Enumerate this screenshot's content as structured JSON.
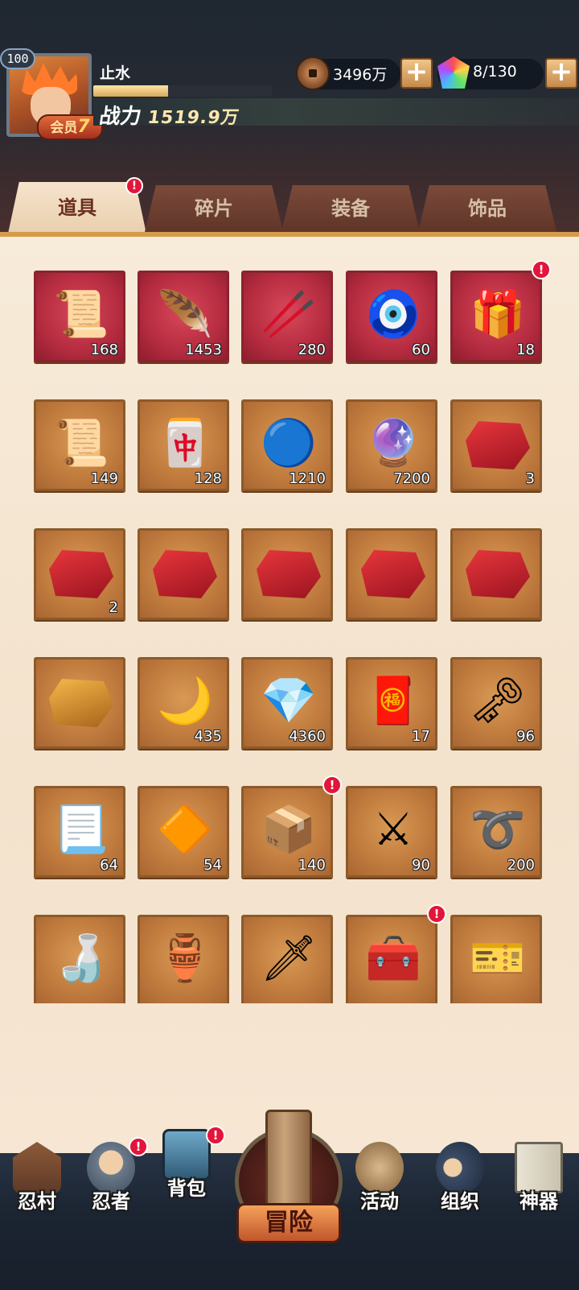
{
  "player": {
    "level": "100",
    "name": "止水",
    "vip_label": "会员",
    "vip_level": "7",
    "power_label": "战力",
    "power_value": "1519.9万",
    "exp_fraction": 0.42
  },
  "resources": {
    "coins": "3496万",
    "gems": "8/130",
    "plus_symbol": "+"
  },
  "tabs": [
    {
      "label": "道具",
      "active": true,
      "alert": "!"
    },
    {
      "label": "碎片",
      "active": false
    },
    {
      "label": "装备",
      "active": false
    },
    {
      "label": "饰品",
      "active": false
    }
  ],
  "items": [
    {
      "icon": "scroll-bundle-icon",
      "glyph": "📜",
      "count": "168",
      "rarity": "red"
    },
    {
      "icon": "red-feather-icon",
      "glyph": "🪶",
      "count": "1453",
      "rarity": "red"
    },
    {
      "icon": "wooden-stick-icon",
      "glyph": "🥢",
      "count": "280",
      "rarity": "red"
    },
    {
      "icon": "green-jade-pendant-icon",
      "glyph": "🧿",
      "count": "60",
      "rarity": "red"
    },
    {
      "icon": "gift-box-icon",
      "glyph": "🎁",
      "count": "18",
      "rarity": "red",
      "alert": "!"
    },
    {
      "icon": "open-scroll-icon",
      "glyph": "📜",
      "count": "149",
      "rarity": "gold"
    },
    {
      "icon": "purple-seal-card-icon",
      "glyph": "🀄",
      "count": "128",
      "rarity": "gold"
    },
    {
      "icon": "blue-orb-icon",
      "glyph": "🔵",
      "count": "1210",
      "rarity": "gold"
    },
    {
      "icon": "purple-crystal-orb-icon",
      "glyph": "🔮",
      "count": "7200",
      "rarity": "gold"
    },
    {
      "icon": "red-fist-stone-icon",
      "glyph": "",
      "count": "3",
      "rarity": "gold",
      "stone": "red"
    },
    {
      "icon": "red-figure-stone-icon",
      "glyph": "",
      "count": "2",
      "rarity": "gold",
      "stone": "red"
    },
    {
      "icon": "red-hand-stone-icon",
      "glyph": "",
      "count": "",
      "rarity": "gold",
      "stone": "red"
    },
    {
      "icon": "red-burst-stone-icon",
      "glyph": "",
      "count": "",
      "rarity": "gold",
      "stone": "red"
    },
    {
      "icon": "red-target-stone-icon",
      "glyph": "",
      "count": "",
      "rarity": "gold",
      "stone": "red"
    },
    {
      "icon": "red-eye-stone-icon",
      "glyph": "",
      "count": "",
      "rarity": "gold",
      "stone": "red"
    },
    {
      "icon": "gold-swirl-stone-icon",
      "glyph": "",
      "count": "",
      "rarity": "gold",
      "stone": "gold"
    },
    {
      "icon": "blue-crescent-icon",
      "glyph": "🌙",
      "count": "435",
      "rarity": "gold"
    },
    {
      "icon": "purple-crystal-shard-icon",
      "glyph": "💎",
      "count": "4360",
      "rarity": "gold"
    },
    {
      "icon": "fortune-banner-icon",
      "glyph": "🧧",
      "count": "17",
      "rarity": "gold"
    },
    {
      "icon": "bronze-key-icon",
      "glyph": "🗝",
      "count": "96",
      "rarity": "gold"
    },
    {
      "icon": "seal-paper-icon",
      "glyph": "📃",
      "count": "64",
      "rarity": "gold"
    },
    {
      "icon": "amber-hammer-gem-icon",
      "glyph": "🔶",
      "count": "54",
      "rarity": "gold"
    },
    {
      "icon": "golden-chest-icon",
      "glyph": "📦",
      "count": "140",
      "rarity": "gold",
      "alert": "!"
    },
    {
      "icon": "steel-claw-weapon-icon",
      "glyph": "⚔",
      "count": "90",
      "rarity": "gold"
    },
    {
      "icon": "rope-lasso-icon",
      "glyph": "➰",
      "count": "200",
      "rarity": "gold"
    },
    {
      "icon": "gourd-icon",
      "glyph": "🍶",
      "count": "",
      "rarity": "gold"
    },
    {
      "icon": "sake-jar-icon",
      "glyph": "🏺",
      "count": "",
      "rarity": "gold"
    },
    {
      "icon": "kunai-pouch-icon",
      "glyph": "🗡",
      "count": "",
      "rarity": "gold"
    },
    {
      "icon": "purple-treasure-box-icon",
      "glyph": "🧰",
      "count": "",
      "rarity": "gold",
      "alert": "!"
    },
    {
      "icon": "point-card-icon",
      "glyph": "🎫",
      "count": "",
      "rarity": "gold"
    }
  ],
  "nav": [
    {
      "label": "忍村",
      "icon": "village-gate-icon",
      "alert": ""
    },
    {
      "label": "忍者",
      "icon": "ninja-portrait-icon",
      "alert": "!"
    },
    {
      "label": "背包",
      "icon": "backpack-icon",
      "alert": "!"
    },
    {
      "label": "冒险",
      "icon": "adventure-scroll-icon",
      "alert": ""
    },
    {
      "label": "活动",
      "icon": "crossed-swords-drum-icon",
      "alert": ""
    },
    {
      "label": "组织",
      "icon": "organization-ninjas-icon",
      "alert": ""
    },
    {
      "label": "神器",
      "icon": "artifact-scroll-icon",
      "alert": ""
    }
  ],
  "colors": {
    "accent": "#d59b4b",
    "alert": "#e3153a",
    "panel": "#f5e6d2"
  }
}
